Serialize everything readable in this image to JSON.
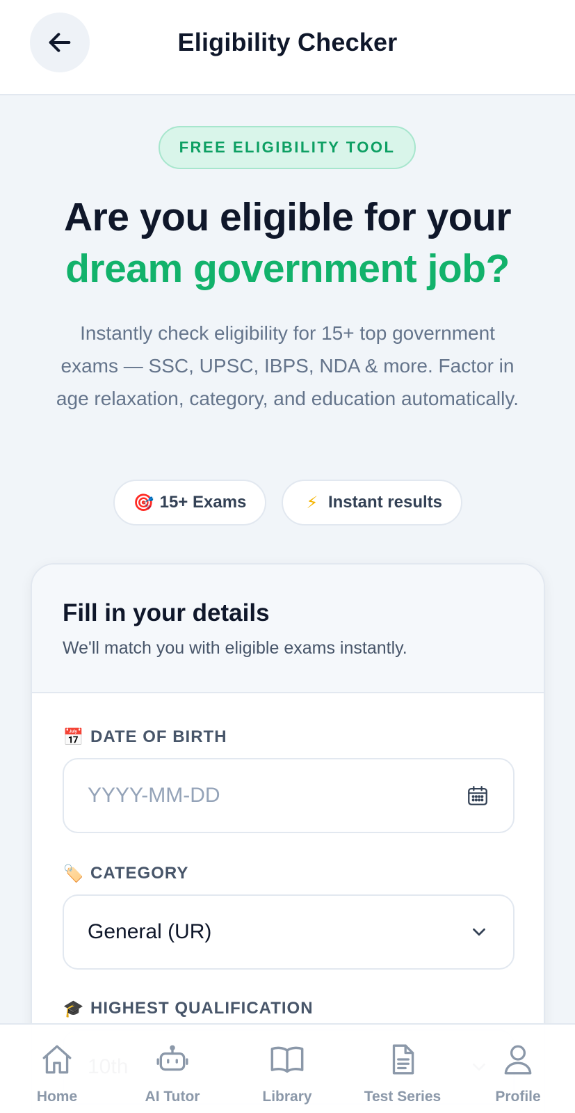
{
  "header": {
    "title": "Eligibility Checker",
    "back_icon": "arrow-left-icon"
  },
  "hero": {
    "badge": "FREE ELIGIBILITY TOOL",
    "title_line1": "Are you eligible for your",
    "title_line2": "dream government job?",
    "description": "Instantly check eligibility for 15+ top government exams — SSC, UPSC, IBPS, NDA & more. Factor in age relaxation, category, and education automatically.",
    "accent_color": "#12b26b"
  },
  "chips": [
    {
      "icon": "target-icon",
      "glyph": "🎯",
      "label": "15+ Exams"
    },
    {
      "icon": "lightning-icon",
      "glyph": "⚡",
      "label": "Instant results"
    }
  ],
  "form": {
    "title": "Fill in your details",
    "subtitle": "We'll match you with eligible exams instantly.",
    "dob": {
      "label_icon": "calendar-emoji-icon",
      "glyph": "📅",
      "label": "DATE OF BIRTH",
      "placeholder": "YYYY-MM-DD",
      "value": ""
    },
    "category": {
      "label_icon": "tag-icon",
      "glyph": "🏷️",
      "label": "CATEGORY",
      "value": "General (UR)"
    },
    "qualification": {
      "label_icon": "graduation-cap-icon",
      "glyph": "🎓",
      "label": "HIGHEST QUALIFICATION",
      "value": "10th"
    }
  },
  "nav": [
    {
      "icon": "home-icon",
      "label": "Home"
    },
    {
      "icon": "robot-icon",
      "label": "AI Tutor"
    },
    {
      "icon": "book-icon",
      "label": "Library"
    },
    {
      "icon": "document-icon",
      "label": "Test Series"
    },
    {
      "icon": "user-icon",
      "label": "Profile"
    }
  ]
}
